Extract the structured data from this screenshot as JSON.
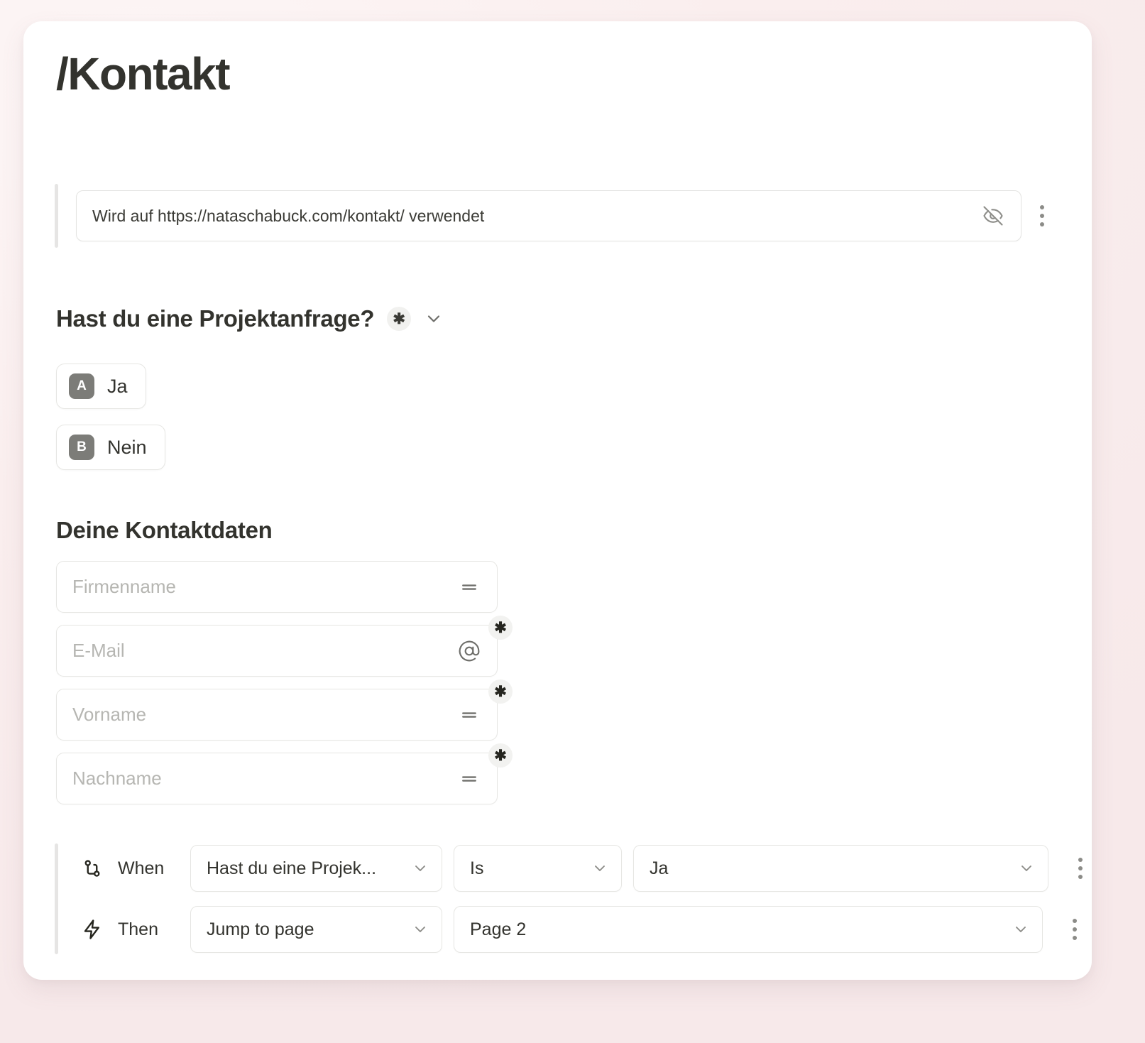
{
  "page": {
    "title": "/Kontakt",
    "background_color": "#fbf2f2",
    "card_color": "#ffffff"
  },
  "url_field": {
    "value": "Wird auf https://nataschabuck.com/kontakt/ verwendet",
    "placeholder": "Wird auf https://nataschabuck.com/kontakt/ verwendet",
    "visibility_icon": "eye-off-icon",
    "menu_icon": "more-vertical-icon"
  },
  "question": {
    "label": "Hast du eine Projektanfrage?",
    "required_marker": "✱",
    "collapse_icon": "chevron-down-icon",
    "options": [
      {
        "key": "A",
        "label": "Ja"
      },
      {
        "key": "B",
        "label": "Nein"
      }
    ],
    "key_badge_color": "#7c7c78"
  },
  "contact_section": {
    "heading": "Deine Kontaktdaten",
    "fields": [
      {
        "placeholder": "Firmenname",
        "value": "",
        "icon": "text-field-icon",
        "required": false,
        "required_marker": ""
      },
      {
        "placeholder": "E-Mail",
        "value": "",
        "icon": "at-sign-icon",
        "required": true,
        "required_marker": "✱"
      },
      {
        "placeholder": "Vorname",
        "value": "",
        "icon": "text-field-icon",
        "required": true,
        "required_marker": "✱"
      },
      {
        "placeholder": "Nachname",
        "value": "",
        "icon": "text-field-icon",
        "required": true,
        "required_marker": "✱"
      }
    ]
  },
  "logic": {
    "when": {
      "icon": "git-branch-icon",
      "label": "When",
      "subject": "Hast du eine Projek...",
      "operator": "Is",
      "value": "Ja",
      "menu_icon": "more-vertical-icon"
    },
    "then": {
      "icon": "lightning-bolt-icon",
      "label": "Then",
      "action": "Jump to page",
      "target": "Page 2",
      "menu_icon": "more-vertical-icon"
    }
  }
}
